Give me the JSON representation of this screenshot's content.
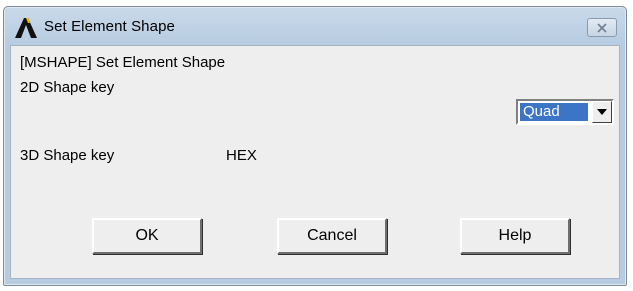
{
  "window": {
    "title": "Set Element Shape"
  },
  "dialog": {
    "heading": "[MSHAPE] Set Element Shape",
    "shape2d_label": "2D Shape key",
    "shape2d_value": "Quad",
    "shape3d_label": "3D Shape key",
    "shape3d_value": "HEX"
  },
  "buttons": {
    "ok": "OK",
    "cancel": "Cancel",
    "help": "Help"
  },
  "icons": {
    "app": "ansys-logo-icon",
    "close": "close-icon",
    "dropdown": "chevron-down-icon"
  },
  "colors": {
    "selection": "#3c75c6",
    "title_bar": "#b7cce1",
    "dialog_background": "#eeeeee"
  }
}
